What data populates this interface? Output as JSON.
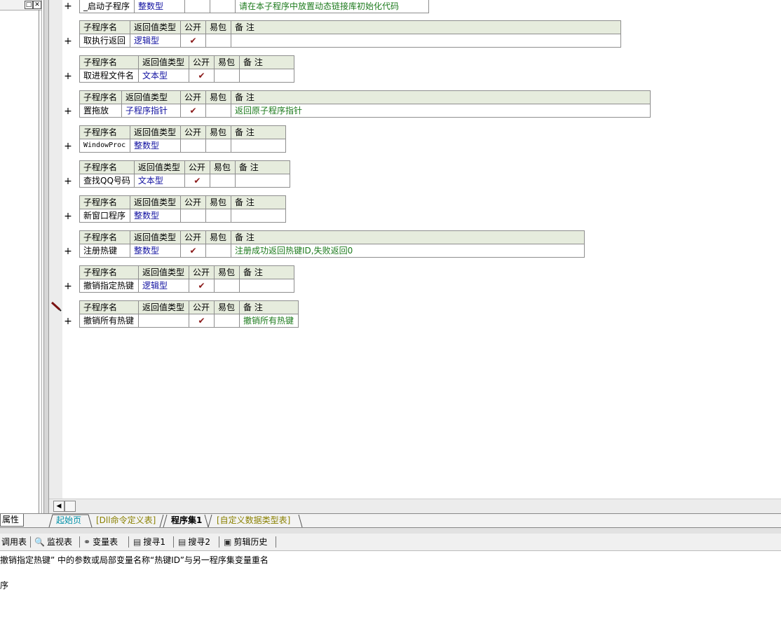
{
  "window": {
    "restore_glyph": "□",
    "close_glyph": "✕"
  },
  "subprograms": [
    {
      "name": "_启动子程序",
      "ret": "整数型",
      "pub": "",
      "pack": "",
      "remark": "请在本子程序中放置动态链接库初始化代码",
      "headerless": true
    },
    {
      "name": "取执行返回",
      "ret": "逻辑型",
      "pub": "✔",
      "pack": "",
      "remark": ""
    },
    {
      "name": "取进程文件名",
      "ret": "文本型",
      "pub": "✔",
      "pack": "",
      "remark": ""
    },
    {
      "name": "置拖放",
      "ret": "子程序指针",
      "pub": "✔",
      "pack": "",
      "remark": "返回原子程序指针"
    },
    {
      "name": "WindowProc",
      "ret": "整数型",
      "pub": "",
      "pack": "",
      "remark": ""
    },
    {
      "name": "查找QQ号码",
      "ret": "文本型",
      "pub": "✔",
      "pack": "",
      "remark": ""
    },
    {
      "name": "新窗口程序",
      "ret": "整数型",
      "pub": "",
      "pack": "",
      "remark": ""
    },
    {
      "name": "注册热键",
      "ret": "整数型",
      "pub": "✔",
      "pack": "",
      "remark": "注册成功返回热键ID,失败返回0"
    },
    {
      "name": "撤销指定热键",
      "ret": "逻辑型",
      "pub": "✔",
      "pack": "",
      "remark": ""
    },
    {
      "name": "撤销所有热键",
      "ret": "",
      "pub": "✔",
      "pack": "",
      "remark": "撤销所有热键"
    }
  ],
  "headers": {
    "name": "子程序名",
    "ret": "返回值类型",
    "pub": "公开",
    "pack": "易包",
    "remark": "备 注"
  },
  "expand_glyph": "+",
  "scroll": {
    "left_arrow": "◀"
  },
  "left_tab": "属性",
  "doc_tabs": [
    {
      "label": "起始页",
      "style": "cyan"
    },
    {
      "label": "[Dll命令定义表]",
      "style": "olive"
    },
    {
      "label": "程序集1",
      "style": "active"
    },
    {
      "label": "[自定义数据类型表]",
      "style": "olive"
    }
  ],
  "toolbar": [
    {
      "label": "调用表",
      "icon": ""
    },
    {
      "label": "监视表",
      "icon": "🔍"
    },
    {
      "label": "变量表",
      "icon": "⚭"
    },
    {
      "label": "搜寻1",
      "icon": "▤"
    },
    {
      "label": "搜寻2",
      "icon": "▤"
    },
    {
      "label": "剪辑历史",
      "icon": "▣"
    }
  ],
  "output": {
    "line1": "撤销指定热键” 中的参数或局部变量名称“热键ID”与另一程序集变量重名",
    "line2": "序"
  }
}
